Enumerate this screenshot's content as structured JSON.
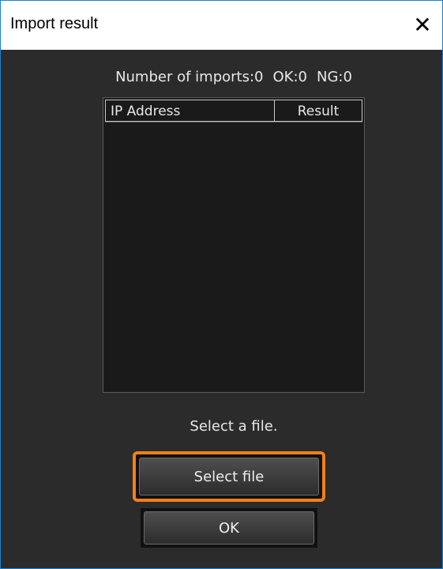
{
  "window": {
    "title": "Import result",
    "close_glyph": "✕"
  },
  "summary": {
    "imports": "Number of imports:0",
    "ok": "OK:0",
    "ng": "NG:0"
  },
  "table": {
    "columns": [
      "IP Address",
      "Result"
    ],
    "rows": []
  },
  "status_text": "Select a file.",
  "buttons": {
    "select_file": "Select file",
    "ok": "OK"
  },
  "colors": {
    "window_border": "#1883d7",
    "background": "#2b2b2b",
    "highlight": "#f0801a"
  }
}
